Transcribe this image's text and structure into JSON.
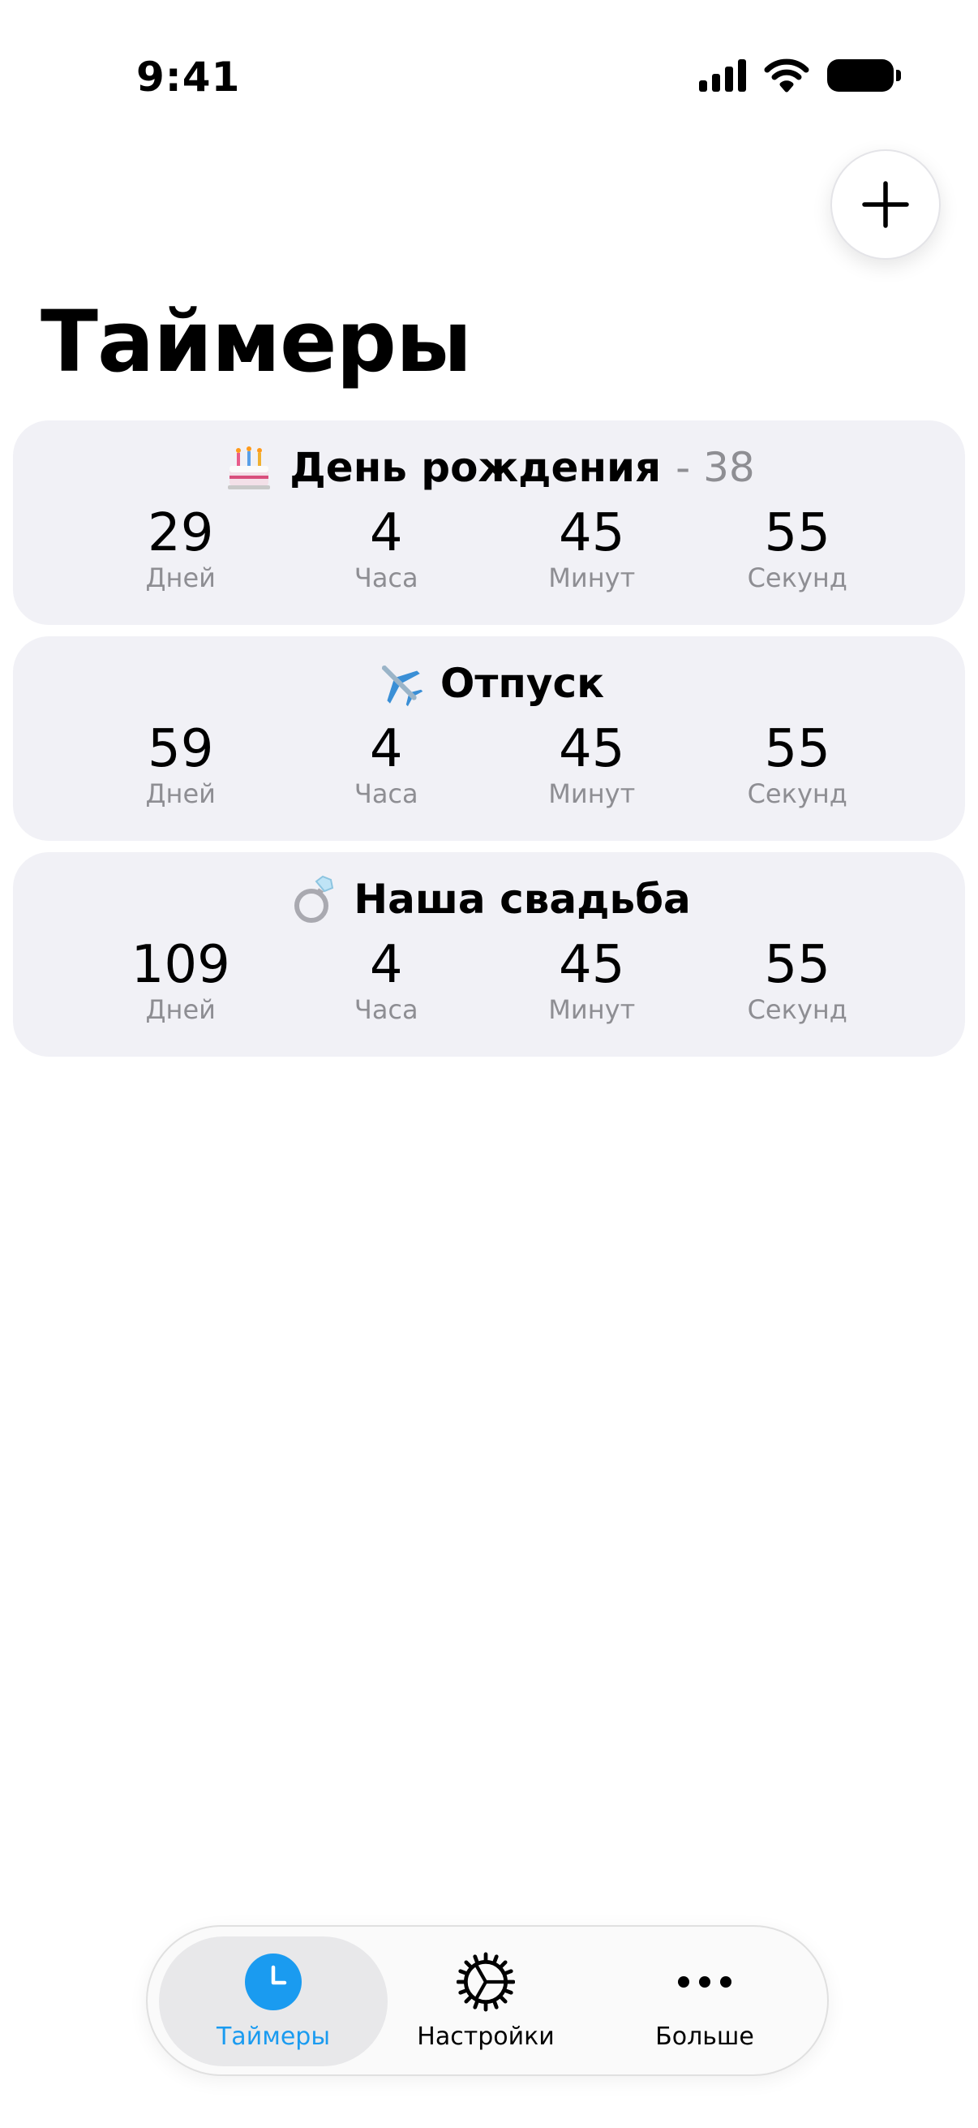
{
  "status_bar": {
    "time": "9:41"
  },
  "header": {
    "title": "Таймеры",
    "add_icon": "plus-icon"
  },
  "timers": [
    {
      "icon": "birthday-cake-icon",
      "name": "День рождения",
      "suffix": "- 38",
      "values": [
        {
          "value": "29",
          "label": "Дней"
        },
        {
          "value": "4",
          "label": "Часа"
        },
        {
          "value": "45",
          "label": "Минут"
        },
        {
          "value": "55",
          "label": "Секунд"
        }
      ]
    },
    {
      "icon": "airplane-icon",
      "name": "Отпуск",
      "suffix": "",
      "values": [
        {
          "value": "59",
          "label": "Дней"
        },
        {
          "value": "4",
          "label": "Часа"
        },
        {
          "value": "45",
          "label": "Минут"
        },
        {
          "value": "55",
          "label": "Секунд"
        }
      ]
    },
    {
      "icon": "ring-icon",
      "name": "Наша свадьба",
      "suffix": "",
      "values": [
        {
          "value": "109",
          "label": "Дней"
        },
        {
          "value": "4",
          "label": "Часа"
        },
        {
          "value": "45",
          "label": "Минут"
        },
        {
          "value": "55",
          "label": "Секунд"
        }
      ]
    }
  ],
  "tab_bar": {
    "items": [
      {
        "label": "Таймеры",
        "icon": "clock-icon",
        "active": true
      },
      {
        "label": "Настройки",
        "icon": "gear-icon",
        "active": false
      },
      {
        "label": "Больше",
        "icon": "more-dots-icon",
        "active": false
      }
    ]
  },
  "colors": {
    "accent": "#1a9bf0",
    "card_bg": "#f1f1f6",
    "secondary_text": "#8e8e93"
  }
}
